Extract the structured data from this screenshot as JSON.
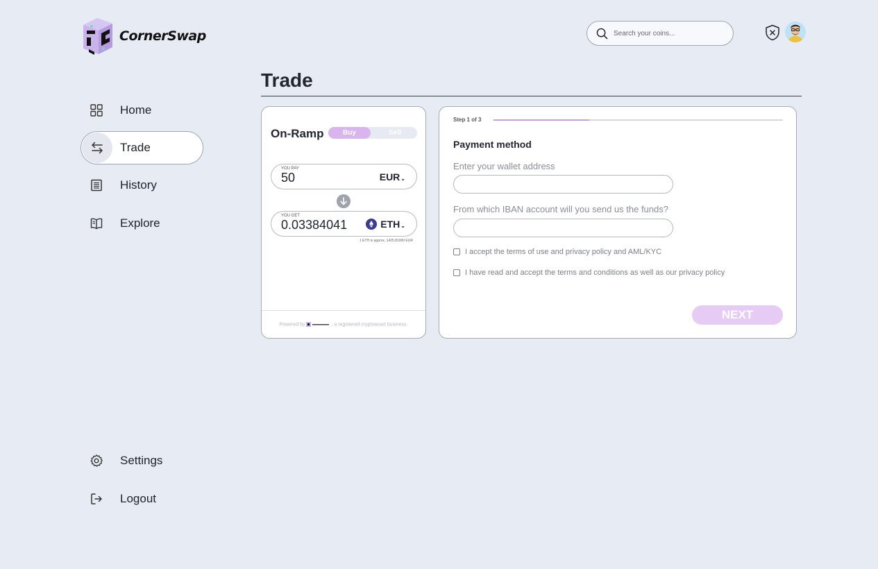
{
  "app": {
    "name": "CornerSwap"
  },
  "header": {
    "search_placeholder": "Search your coins...",
    "icons": [
      "search-icon",
      "shield-close-icon",
      "avatar"
    ]
  },
  "sidebar": {
    "items": [
      {
        "label": "Home",
        "icon": "grid-icon",
        "active": false
      },
      {
        "label": "Trade",
        "icon": "swap-arrows-icon",
        "active": true
      },
      {
        "label": "History",
        "icon": "receipt-icon",
        "active": false
      },
      {
        "label": "Explore",
        "icon": "book-icon",
        "active": false
      }
    ],
    "bottom_items": [
      {
        "label": "Settings",
        "icon": "gear-icon"
      },
      {
        "label": "Logout",
        "icon": "logout-icon"
      }
    ]
  },
  "page": {
    "title": "Trade"
  },
  "widget": {
    "title": "On-Ramp",
    "toggle": {
      "buy": "Buy",
      "sell": "Sell",
      "selected": "Buy"
    },
    "pay": {
      "caption": "YOU PAY",
      "value": "50",
      "currency": "EUR"
    },
    "get": {
      "caption": "YOU GET",
      "value": "0.03384041",
      "currency": "ETH"
    },
    "rate_note": "1 ETH is approx. 1425.81000 EUR",
    "powered_prefix": "Powered by",
    "powered_suffix": ", a registered cryptoasset business."
  },
  "payment": {
    "step": "Step 1 of 3",
    "progress": 0.33,
    "title": "Payment method",
    "wallet_label": "Enter your wallet address",
    "wallet_value": "",
    "iban_label": "From which IBAN account will you send us the funds?",
    "iban_value": "",
    "checkbox_1": "I accept the terms of use and privacy policy and AML/KYC",
    "checkbox_2": "I have read and accept the terms and conditions as well as our privacy policy",
    "next_label": "NEXT"
  },
  "colors": {
    "background": "#e7ebf4",
    "accent": "#d9b5ee",
    "next_button": "#e6ccf4",
    "eth": "#3c3b8f"
  }
}
